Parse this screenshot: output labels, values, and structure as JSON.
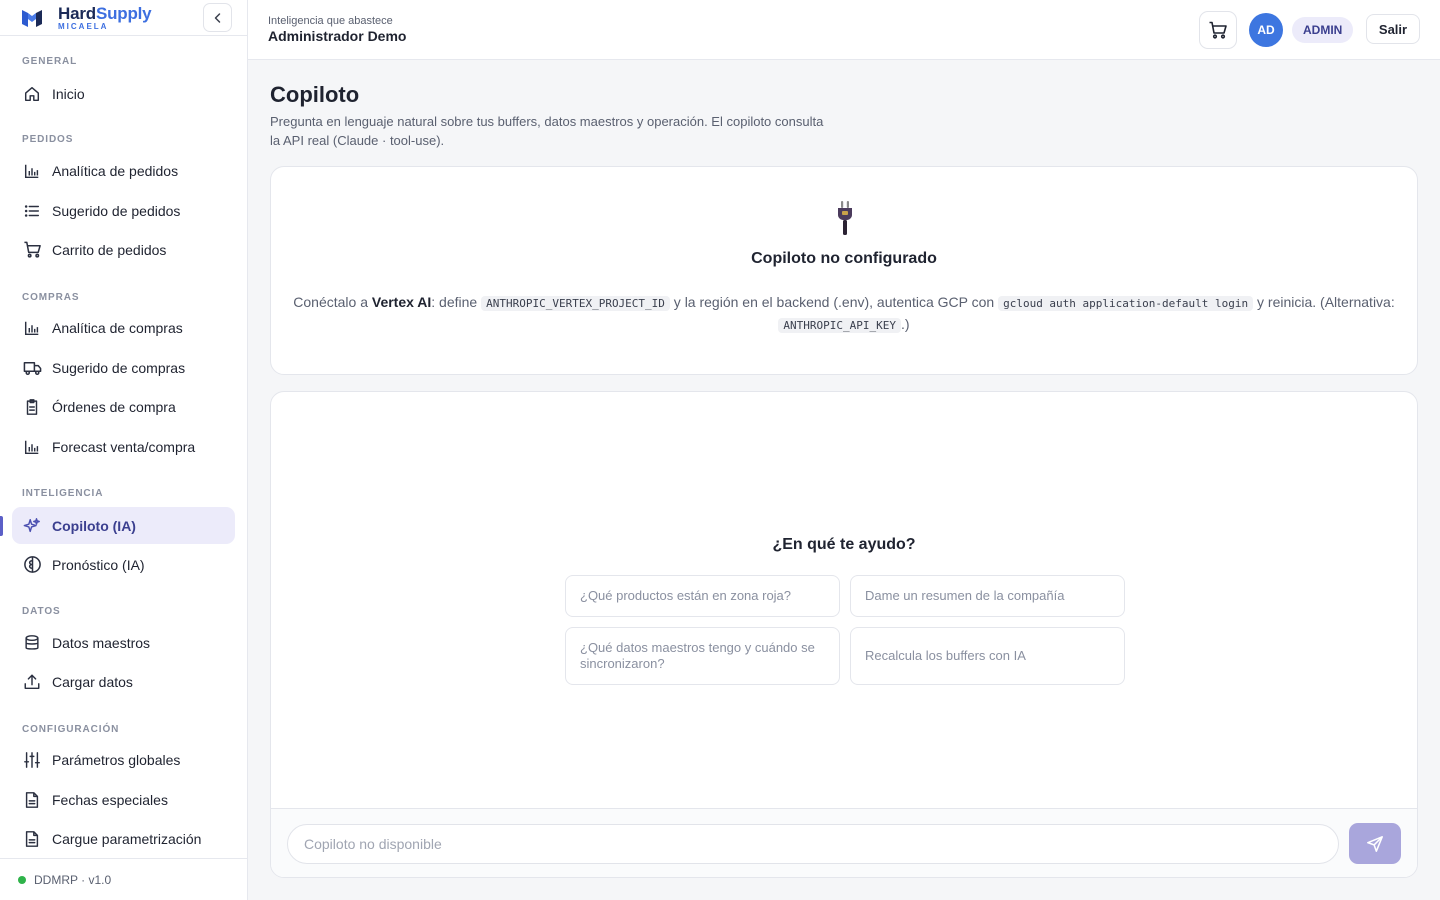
{
  "brand": {
    "name_main": "Hard",
    "name_accent": "Supply",
    "sub": "MICAELA"
  },
  "sidebar": {
    "sections": [
      {
        "label": "GENERAL"
      },
      {
        "label": "PEDIDOS"
      },
      {
        "label": "COMPRAS"
      },
      {
        "label": "INTELIGENCIA"
      },
      {
        "label": "DATOS"
      },
      {
        "label": "CONFIGURACIÓN"
      }
    ],
    "items": [
      {
        "label": "Inicio",
        "icon": "home-icon"
      },
      {
        "label": "Analítica de pedidos",
        "icon": "bar-chart-icon"
      },
      {
        "label": "Sugerido de pedidos",
        "icon": "list-icon"
      },
      {
        "label": "Carrito de pedidos",
        "icon": "cart-icon"
      },
      {
        "label": "Analítica de compras",
        "icon": "bar-chart-icon"
      },
      {
        "label": "Sugerido de compras",
        "icon": "truck-icon"
      },
      {
        "label": "Órdenes de compra",
        "icon": "clipboard-icon"
      },
      {
        "label": "Forecast venta/compra",
        "icon": "bar-chart-icon"
      },
      {
        "label": "Copiloto (IA)",
        "icon": "sparkles-icon",
        "active": true
      },
      {
        "label": "Pronóstico (IA)",
        "icon": "brain-icon"
      },
      {
        "label": "Datos maestros",
        "icon": "database-icon"
      },
      {
        "label": "Cargar datos",
        "icon": "upload-icon"
      },
      {
        "label": "Parámetros globales",
        "icon": "sliders-icon"
      },
      {
        "label": "Fechas especiales",
        "icon": "file-icon"
      },
      {
        "label": "Cargue parametrización",
        "icon": "file-icon"
      }
    ],
    "footer": "DDMRP · v1.0"
  },
  "header": {
    "subtitle": "Inteligencia que abastece",
    "title": "Administrador Demo",
    "avatar": "AD",
    "role": "ADMIN",
    "logout": "Salir"
  },
  "page": {
    "title": "Copiloto",
    "description": "Pregunta en lenguaje natural sobre tus buffers, datos maestros y operación. El copiloto consulta la API real (Claude · tool-use)."
  },
  "notice": {
    "title": "Copiloto no configurado",
    "part1": "Conéctalo a ",
    "bold": "Vertex AI",
    "part2": ": define ",
    "code1": "ANTHROPIC_VERTEX_PROJECT_ID",
    "part3": " y la región en el backend (.env), autentica GCP con ",
    "code2": "gcloud auth application-default login",
    "part4": " y reinicia. (Alternativa: ",
    "code3": "ANTHROPIC_API_KEY",
    "part5": ".)"
  },
  "chat": {
    "title": "¿En qué te ayudo?",
    "suggestions": [
      "¿Qué productos están en zona roja?",
      "Dame un resumen de la compañía",
      "¿Qué datos maestros tengo y cuándo se sincronizaron?",
      "Recalcula los buffers con IA"
    ],
    "input_placeholder": "Copiloto no disponible"
  },
  "colors": {
    "accent": "#5b5fc7",
    "brand": "#3d6fe0",
    "status": "#2fb34a"
  }
}
